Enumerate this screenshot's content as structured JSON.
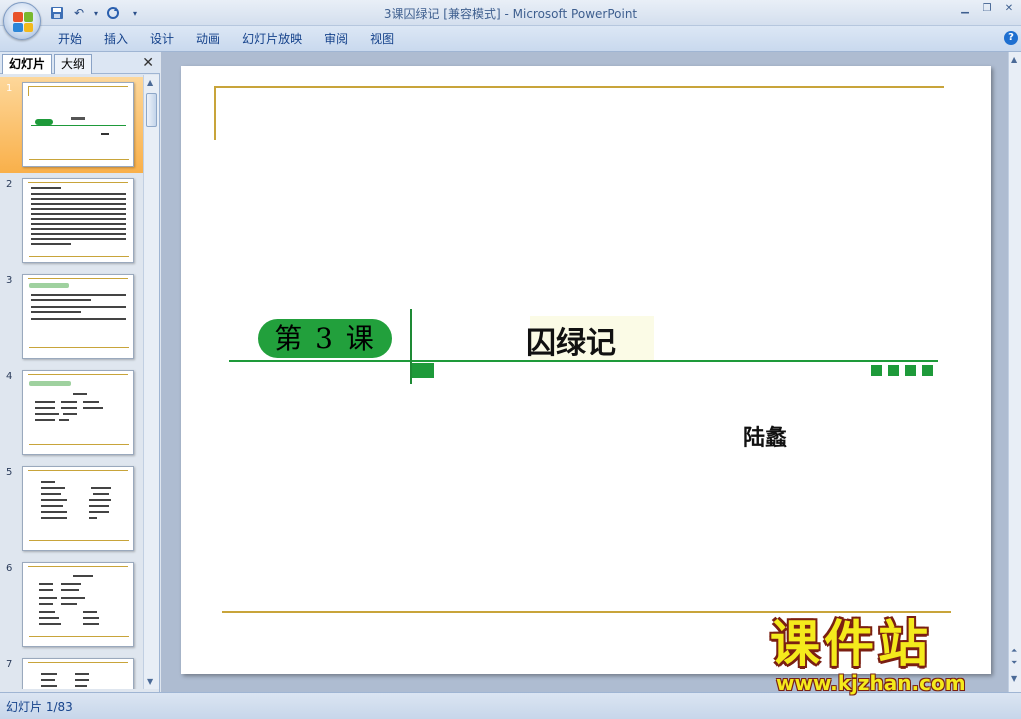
{
  "window": {
    "title": "3课囚绿记 [兼容模式] - Microsoft PowerPoint",
    "controls": [
      "minimize",
      "restore",
      "close"
    ]
  },
  "quick_access": [
    {
      "icon": "save-icon"
    },
    {
      "icon": "undo-icon"
    },
    {
      "icon": "redo-icon"
    },
    {
      "icon": "customize-icon"
    }
  ],
  "ribbon": {
    "tabs": [
      "开始",
      "插入",
      "设计",
      "动画",
      "幻灯片放映",
      "审阅",
      "视图"
    ]
  },
  "left_pane": {
    "tabs": [
      "幻灯片",
      "大纲"
    ],
    "active_tab": "幻灯片",
    "selected_slide": 1,
    "thumbnails": [
      "1",
      "2",
      "3",
      "4",
      "5",
      "6",
      "7"
    ]
  },
  "slide": {
    "lesson_label": "第 3 课",
    "title": "囚绿记",
    "author": "陆蠡",
    "colors": {
      "accent_gold": "#c8a43a",
      "accent_green": "#1e9a3a"
    }
  },
  "watermark": {
    "brand": "课件站",
    "url": "www.kjzhan.com"
  },
  "statusbar": {
    "slide_indicator": "幻灯片 1/83"
  }
}
